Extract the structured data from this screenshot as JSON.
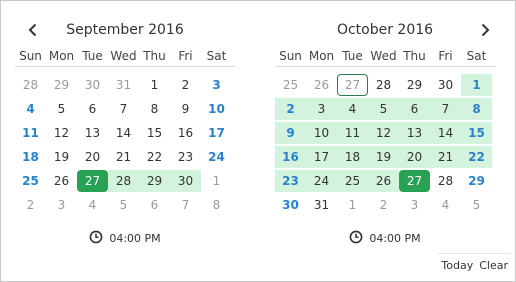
{
  "colors": {
    "accent": "#28a155",
    "range_bg": "#d4f3df",
    "weekend_text": "#2a82c9"
  },
  "icons": {
    "prev": "chevron-left-icon",
    "next": "chevron-right-icon",
    "clock": "clock-icon"
  },
  "weekdays": [
    "Sun",
    "Mon",
    "Tue",
    "Wed",
    "Thu",
    "Fri",
    "Sat"
  ],
  "left_calendar": {
    "title": "September 2016",
    "time": "04:00 PM",
    "days": [
      {
        "d": "28",
        "other": true
      },
      {
        "d": "29",
        "other": true
      },
      {
        "d": "30",
        "other": true
      },
      {
        "d": "31",
        "other": true
      },
      {
        "d": "1"
      },
      {
        "d": "2"
      },
      {
        "d": "3",
        "weekend": true
      },
      {
        "d": "4",
        "weekend": true
      },
      {
        "d": "5"
      },
      {
        "d": "6"
      },
      {
        "d": "7"
      },
      {
        "d": "8"
      },
      {
        "d": "9"
      },
      {
        "d": "10",
        "weekend": true
      },
      {
        "d": "11",
        "weekend": true
      },
      {
        "d": "12"
      },
      {
        "d": "13"
      },
      {
        "d": "14"
      },
      {
        "d": "15"
      },
      {
        "d": "16"
      },
      {
        "d": "17",
        "weekend": true
      },
      {
        "d": "18",
        "weekend": true
      },
      {
        "d": "19"
      },
      {
        "d": "20"
      },
      {
        "d": "21"
      },
      {
        "d": "22"
      },
      {
        "d": "23"
      },
      {
        "d": "24",
        "weekend": true
      },
      {
        "d": "25",
        "weekend": true
      },
      {
        "d": "26"
      },
      {
        "d": "27",
        "selected": true
      },
      {
        "d": "28",
        "range": true
      },
      {
        "d": "29",
        "range": true
      },
      {
        "d": "30",
        "range": true
      },
      {
        "d": "1",
        "other": true
      },
      {
        "d": "2",
        "other": true
      },
      {
        "d": "3",
        "other": true
      },
      {
        "d": "4",
        "other": true
      },
      {
        "d": "5",
        "other": true
      },
      {
        "d": "6",
        "other": true
      },
      {
        "d": "7",
        "other": true
      },
      {
        "d": "8",
        "other": true
      }
    ]
  },
  "right_calendar": {
    "title": "October 2016",
    "time": "04:00 PM",
    "days": [
      {
        "d": "25",
        "other": true
      },
      {
        "d": "26",
        "other": true
      },
      {
        "d": "27",
        "other": true,
        "today": true
      },
      {
        "d": "28",
        "other": true,
        "dark": true
      },
      {
        "d": "29",
        "other": true,
        "dark": true
      },
      {
        "d": "30",
        "other": true,
        "dark": true
      },
      {
        "d": "1",
        "weekend": true,
        "range": true
      },
      {
        "d": "2",
        "weekend": true,
        "range": true
      },
      {
        "d": "3",
        "range": true
      },
      {
        "d": "4",
        "range": true
      },
      {
        "d": "5",
        "range": true
      },
      {
        "d": "6",
        "range": true
      },
      {
        "d": "7",
        "range": true
      },
      {
        "d": "8",
        "weekend": true,
        "range": true
      },
      {
        "d": "9",
        "weekend": true,
        "range": true
      },
      {
        "d": "10",
        "range": true
      },
      {
        "d": "11",
        "range": true
      },
      {
        "d": "12",
        "range": true
      },
      {
        "d": "13",
        "range": true
      },
      {
        "d": "14",
        "range": true
      },
      {
        "d": "15",
        "weekend": true,
        "range": true
      },
      {
        "d": "16",
        "weekend": true,
        "range": true
      },
      {
        "d": "17",
        "range": true
      },
      {
        "d": "18",
        "range": true
      },
      {
        "d": "19",
        "range": true
      },
      {
        "d": "20",
        "range": true
      },
      {
        "d": "21",
        "range": true
      },
      {
        "d": "22",
        "weekend": true,
        "range": true
      },
      {
        "d": "23",
        "weekend": true,
        "range": true
      },
      {
        "d": "24",
        "range": true
      },
      {
        "d": "25",
        "range": true
      },
      {
        "d": "26",
        "range": true
      },
      {
        "d": "27",
        "selected": true
      },
      {
        "d": "28"
      },
      {
        "d": "29",
        "weekend": true
      },
      {
        "d": "30",
        "weekend": true
      },
      {
        "d": "31"
      },
      {
        "d": "1",
        "other": true
      },
      {
        "d": "2",
        "other": true
      },
      {
        "d": "3",
        "other": true
      },
      {
        "d": "4",
        "other": true
      },
      {
        "d": "5",
        "other": true
      }
    ]
  },
  "footer": {
    "today_label": "Today",
    "clear_label": "Clear"
  }
}
